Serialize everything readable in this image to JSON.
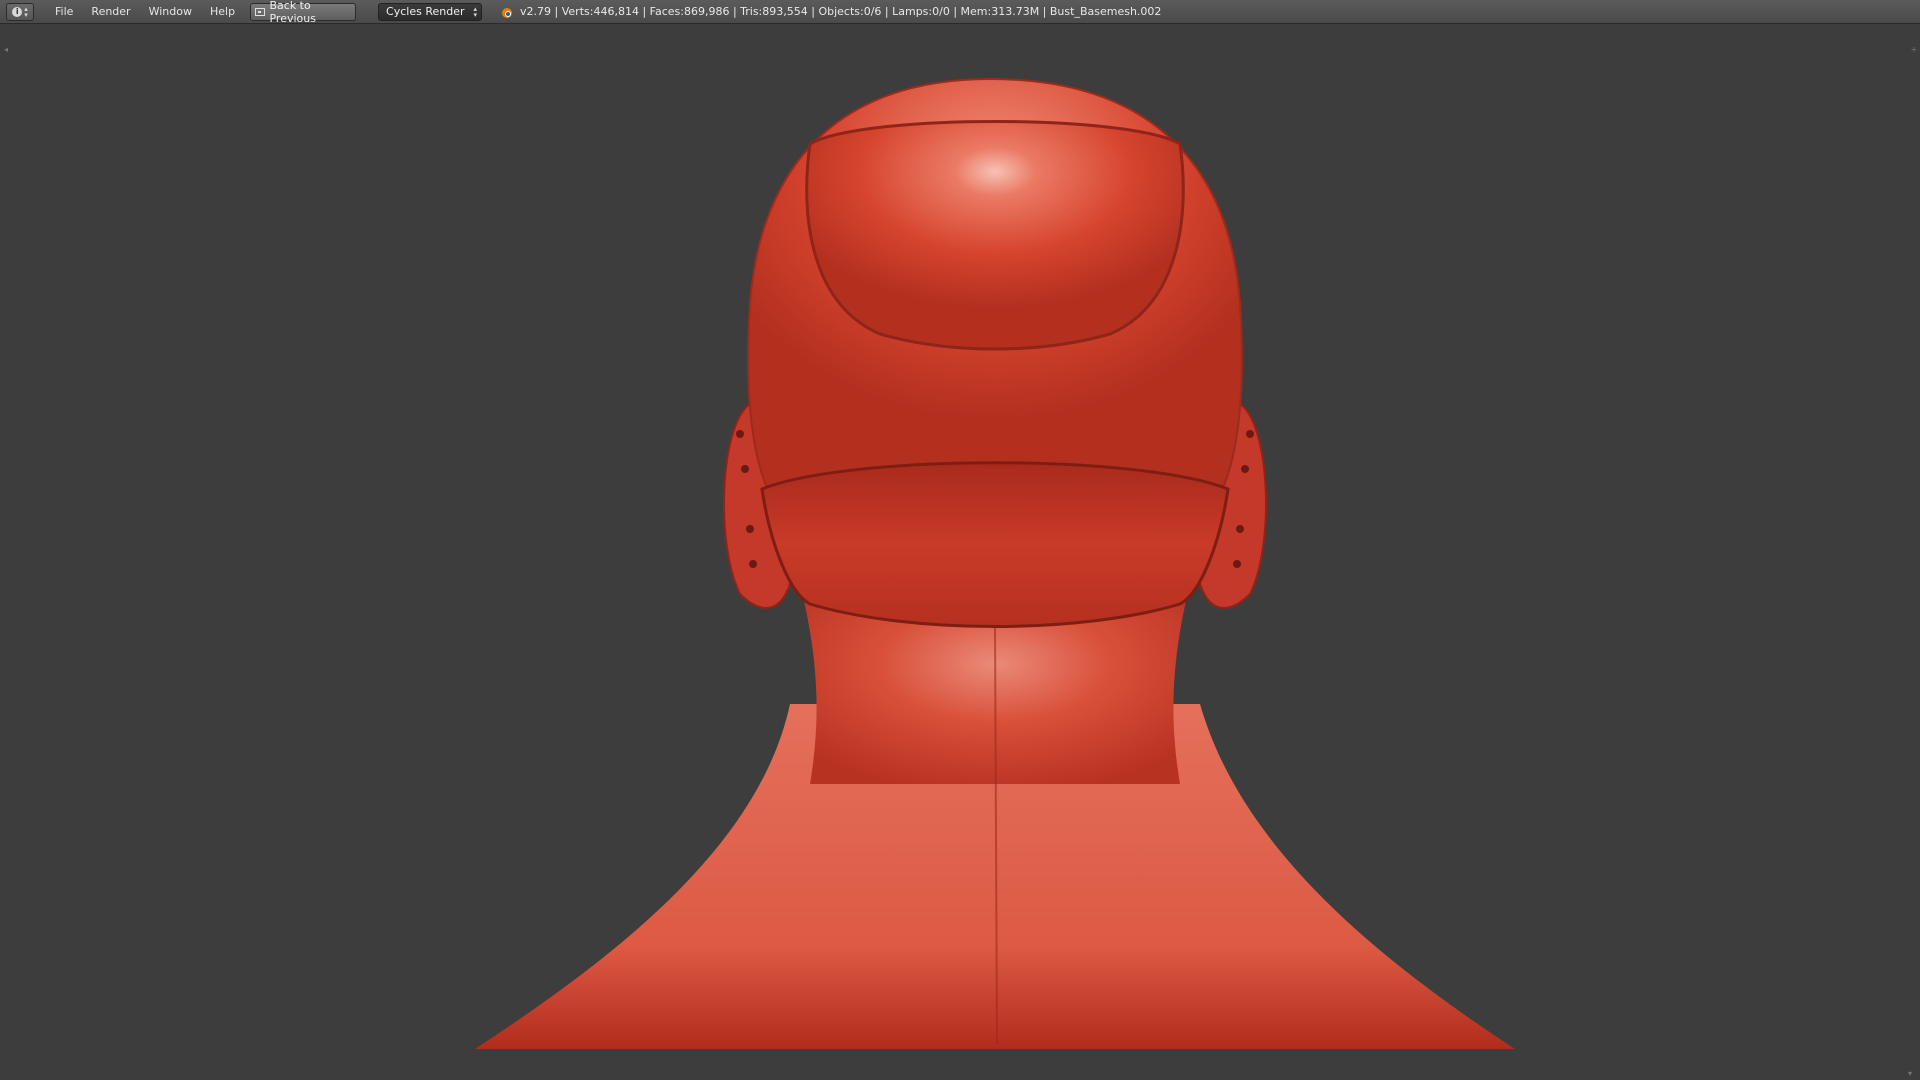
{
  "header": {
    "editor_type_icon": "info-icon",
    "menus": [
      "File",
      "Render",
      "Window",
      "Help"
    ],
    "back_button_label": "Back to Previous",
    "render_engine": "Cycles Render",
    "stats": "v2.79 | Verts:446,814 | Faces:869,986 | Tris:893,554 | Objects:0/6 | Lamps:0/0 | Mem:313.73M | Bust_Basemesh.002"
  },
  "viewport": {
    "background_color": "#3d3d3d",
    "model_color": "#d8402a"
  }
}
